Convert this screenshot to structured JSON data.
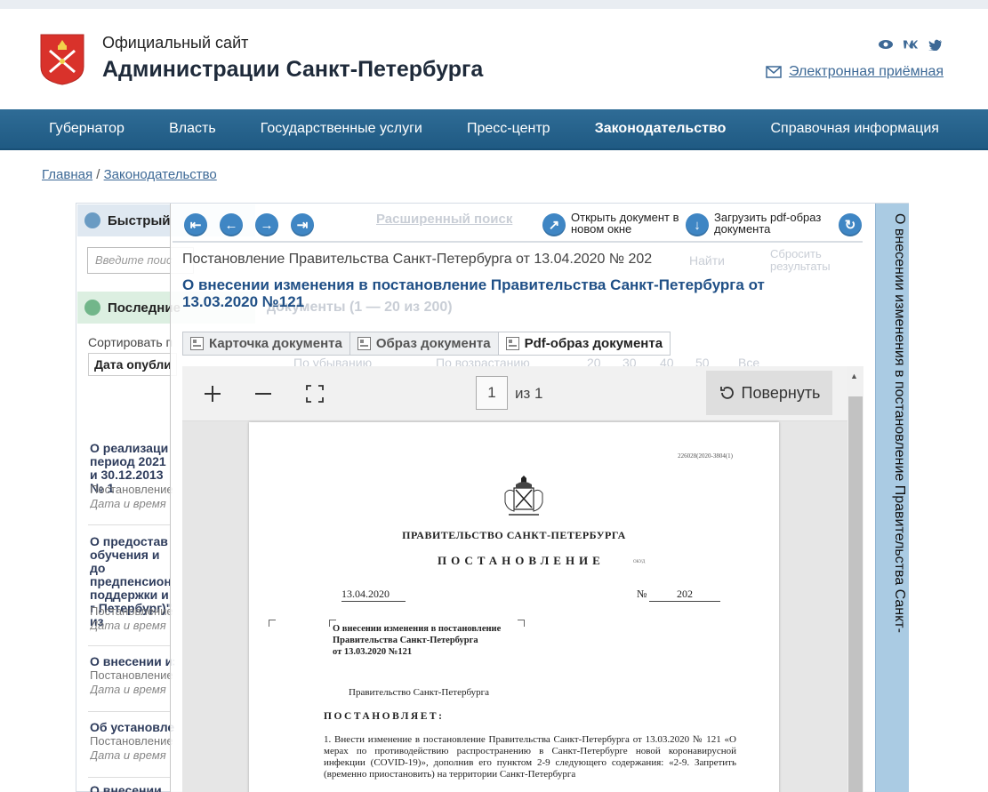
{
  "header": {
    "subtitle": "Официальный сайт",
    "title": "Администрации Санкт-Петербурга",
    "social": [
      "eye-icon",
      "vk-icon",
      "twitter-icon"
    ],
    "reception_link": "Электронная приёмная"
  },
  "nav": {
    "items": [
      {
        "label": "Губернатор"
      },
      {
        "label": "Власть"
      },
      {
        "label": "Государственные услуги"
      },
      {
        "label": "Пресс-центр"
      },
      {
        "label": "Законодательство",
        "active": true
      },
      {
        "label": "Справочная информация"
      }
    ]
  },
  "breadcrumb": {
    "home": "Главная",
    "separator": "/",
    "current": "Законодательство"
  },
  "background": {
    "quick_search_label": "Быстрый",
    "search_placeholder": "Введите поис",
    "recent_label": "Последние",
    "sort_label": "Сортировать п",
    "sort_value": "Дата опубли",
    "advanced_search": "Расширенный поиск",
    "find": "Найти",
    "reset": "Сбросить результаты",
    "recent_count": "документы (1 — 20 из 200)",
    "per_page": [
      "20",
      "30",
      "40",
      "50",
      "Все"
    ],
    "sort_desc": "По убыванию",
    "sort_asc": "По возрастанию",
    "items": [
      {
        "title": "О реализаци период 2021 и 30.12.2013 № 1",
        "sub": "Постановление",
        "date": "Дата и время"
      },
      {
        "title": "О предостав обучения и до предпенсион поддержки и г Петербург)\" из",
        "sub": "Постановление",
        "date": "Дата и время"
      },
      {
        "title": "О внесении из",
        "sub": "Постановление",
        "date": "Дата и время"
      },
      {
        "title": "Об установле",
        "sub": "Постановление",
        "date": "Дата и время"
      },
      {
        "title": "О внесении",
        "sub": "",
        "date": ""
      }
    ]
  },
  "modal": {
    "toolbar": {
      "open_new_window": "Открыть документ в новом окне",
      "download_pdf": "Загрузить pdf-образ документа"
    },
    "doc_meta": "Постановление Правительства Санкт-Петербурга от 13.04.2020 № 202",
    "doc_title": "О внесении изменения в постановление Правительства Санкт-Петербурга от 13.03.2020 №121",
    "tabs": [
      {
        "label": "Карточка документа"
      },
      {
        "label": "Образ документа"
      },
      {
        "label": "Pdf-образ документа",
        "active": true
      }
    ],
    "viewer": {
      "page_current": "1",
      "page_of": "из 1",
      "rotate_label": "Повернуть"
    },
    "side_title": "О внесении изменения в постановление Правительства Санкт-"
  },
  "pdf": {
    "reg_number": "226028(2020-3804(1)",
    "government": "ПРАВИТЕЛЬСТВО САНКТ-ПЕТЕРБУРГА",
    "doc_type": "ПОСТАНОВЛЕНИЕ",
    "okud": "ОКУД",
    "date": "13.04.2020",
    "number_label": "№",
    "number": "202",
    "subject_line1": "О внесении изменения в постановление",
    "subject_line2": "Правительства Санкт-Петербурга",
    "subject_line3": "от 13.03.2020 №121",
    "government_lower": "Правительство Санкт-Петербурга",
    "decrees": "ПОСТАНОВЛЯЕТ:",
    "body": "1. Внести изменение в постановление Правительства Санкт-Петербурга от 13.03.2020 № 121 «О мерах по противодействию распространению в Санкт-Петербурге новой коронавирусной инфекции (COVID-19)», дополнив его пунктом 2-9 следующего содержания: «2-9. Запретить (временно приостановить) на территории Санкт-Петербурга"
  }
}
